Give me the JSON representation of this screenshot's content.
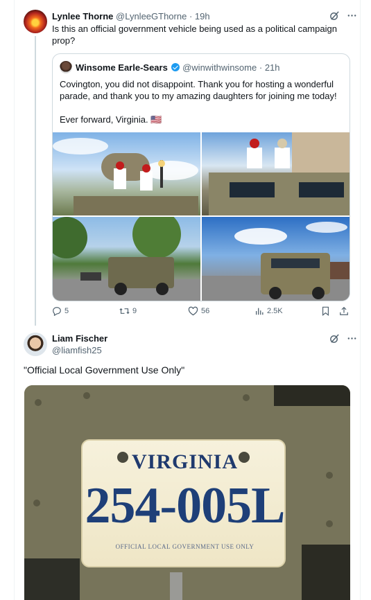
{
  "tweet1": {
    "name": "Lynlee Thorne",
    "handle": "@LynleeGThorne",
    "sep": "·",
    "time": "19h",
    "text": "Is this an official government vehicle being used as a political campaign prop?",
    "quote": {
      "name": "Winsome Earle-Sears",
      "handle": "@winwithwinsome",
      "sep": "·",
      "time": "21h",
      "text1": "Covington, you did not disappoint. Thank you for hosting a wonderful parade, and thank you to my amazing daughters for joining me today!",
      "text2": "Ever forward, Virginia. 🇺🇸"
    },
    "stats": {
      "replies": "5",
      "reposts": "9",
      "likes": "56",
      "views": "2.5K"
    }
  },
  "tweet2": {
    "name": "Liam Fischer",
    "handle": "@liamfish25",
    "text": "\"Official Local Government Use Only\"",
    "plate": {
      "state": "VIRGINIA",
      "number": "254-005L",
      "footer": "OFFICIAL LOCAL GOVERNMENT USE ONLY"
    }
  },
  "icons": {
    "grok": "grok-icon",
    "more": "more-icon",
    "reply": "reply-icon",
    "repost": "repost-icon",
    "like": "heart-icon",
    "views": "views-icon",
    "bookmark": "bookmark-icon",
    "share": "share-icon"
  },
  "colors": {
    "text": "#0f1419",
    "muted": "#536471",
    "verified": "#1d9bf0",
    "border": "#cfd9de"
  }
}
